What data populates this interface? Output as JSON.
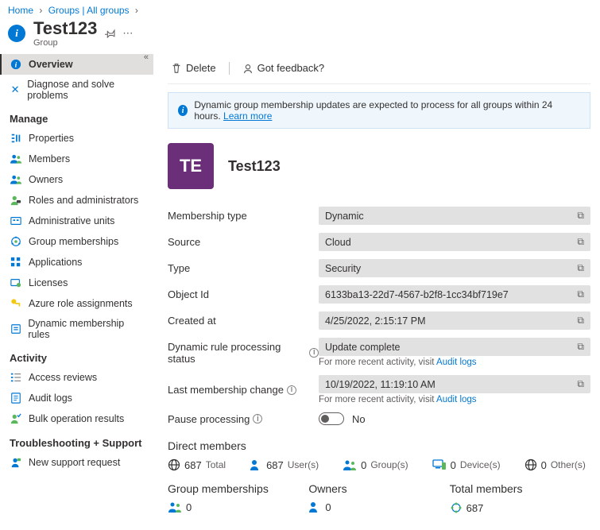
{
  "breadcrumb": {
    "home": "Home",
    "groups": "Groups | All groups"
  },
  "header": {
    "title": "Test123",
    "subtitle": "Group"
  },
  "sidebar": {
    "overview": "Overview",
    "diagnose": "Diagnose and solve problems",
    "manage_header": "Manage",
    "properties": "Properties",
    "members": "Members",
    "owners": "Owners",
    "roles": "Roles and administrators",
    "admin_units": "Administrative units",
    "group_memberships": "Group memberships",
    "applications": "Applications",
    "licenses": "Licenses",
    "azure_roles": "Azure role assignments",
    "dynamic_rules": "Dynamic membership rules",
    "activity_header": "Activity",
    "access_reviews": "Access reviews",
    "audit_logs": "Audit logs",
    "bulk_results": "Bulk operation results",
    "trouble_header": "Troubleshooting + Support",
    "new_request": "New support request"
  },
  "toolbar": {
    "delete": "Delete",
    "feedback": "Got feedback?"
  },
  "banner": {
    "text": "Dynamic group membership updates are expected to process for all groups within 24 hours.",
    "learn_more": "Learn more"
  },
  "group": {
    "initials": "TE",
    "name": "Test123"
  },
  "props": {
    "membership_type_label": "Membership type",
    "membership_type": "Dynamic",
    "source_label": "Source",
    "source": "Cloud",
    "type_label": "Type",
    "type": "Security",
    "objectid_label": "Object Id",
    "objectid": "6133ba13-22d7-4567-b2f8-1cc34bf719e7",
    "created_label": "Created at",
    "created": "4/25/2022, 2:15:17 PM",
    "status_label": "Dynamic rule processing status",
    "status": "Update complete",
    "recent_activity_prefix": "For more recent activity, visit ",
    "audit_link": "Audit logs",
    "last_change_label": "Last membership change",
    "last_change": "10/19/2022, 11:19:10 AM",
    "pause_label": "Pause processing",
    "pause_value": "No"
  },
  "stats": {
    "direct_title": "Direct members",
    "total_num": "687",
    "total_lbl": "Total",
    "users_num": "687",
    "users_lbl": "User(s)",
    "groups_num": "0",
    "groups_lbl": "Group(s)",
    "devices_num": "0",
    "devices_lbl": "Device(s)",
    "others_num": "0",
    "others_lbl": "Other(s)",
    "memberships_title": "Group memberships",
    "memberships_num": "0",
    "owners_title": "Owners",
    "owners_num": "0",
    "total_members_title": "Total members",
    "total_members_num": "687"
  }
}
